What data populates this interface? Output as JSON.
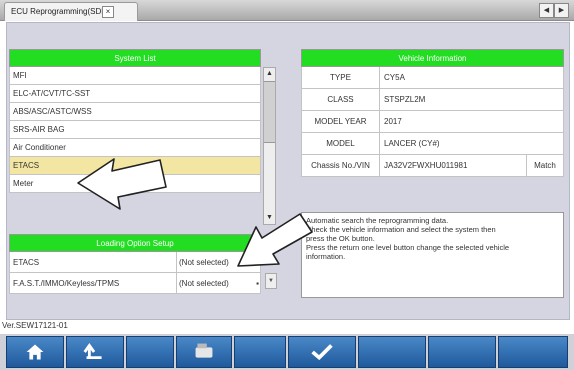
{
  "window": {
    "tab_title": "ECU Reprogramming(SDB)",
    "tab_close_icon": "×",
    "nav_prev": "◀",
    "nav_next": "▶"
  },
  "system_list": {
    "header": "System List",
    "items": [
      {
        "label": "MFI"
      },
      {
        "label": "ELC-AT/CVT/TC-SST"
      },
      {
        "label": "ABS/ASC/ASTC/WSS"
      },
      {
        "label": "SRS-AIR BAG"
      },
      {
        "label": "Air Conditioner"
      },
      {
        "label": "ETACS"
      },
      {
        "label": "Meter"
      }
    ],
    "selected_index": 5
  },
  "loading_option": {
    "header": "Loading Option Setup",
    "rows": [
      {
        "name": "ETACS",
        "value": "(Not selected)"
      },
      {
        "name": "F.A.S.T./IMMO/Keyless/TPMS",
        "value": "(Not selected)"
      }
    ]
  },
  "vehicle_info": {
    "header": "Vehicle Information",
    "rows": [
      {
        "label": "TYPE",
        "value": "CY5A"
      },
      {
        "label": "CLASS",
        "value": "STSPZL2M"
      },
      {
        "label": "MODEL YEAR",
        "value": "2017"
      },
      {
        "label": "MODEL",
        "value": "LANCER (CY#)"
      },
      {
        "label": "Chassis No./VIN",
        "value": "JA32V2FWXHU011981",
        "action": "Match"
      }
    ]
  },
  "message": {
    "lines": [
      "Automatic search the reprogramming data.",
      "Check the vehicle information and select the system then",
      "press the OK button.",
      "Press the return one level button change the selected vehicle",
      "information."
    ]
  },
  "footer": {
    "version": "Ver.SEW17121-01",
    "buttons": [
      {
        "icon": "home-icon"
      },
      {
        "icon": "return-icon"
      },
      {
        "icon": "blank"
      },
      {
        "icon": "ecu-icon"
      },
      {
        "icon": "blank"
      },
      {
        "icon": "check-icon"
      },
      {
        "icon": "blank"
      },
      {
        "icon": "blank"
      },
      {
        "icon": "blank"
      }
    ]
  },
  "colors": {
    "panel_header": "#22dd22",
    "selected_row": "#f3e6a3",
    "toolbar_button": "#2b6db0"
  }
}
